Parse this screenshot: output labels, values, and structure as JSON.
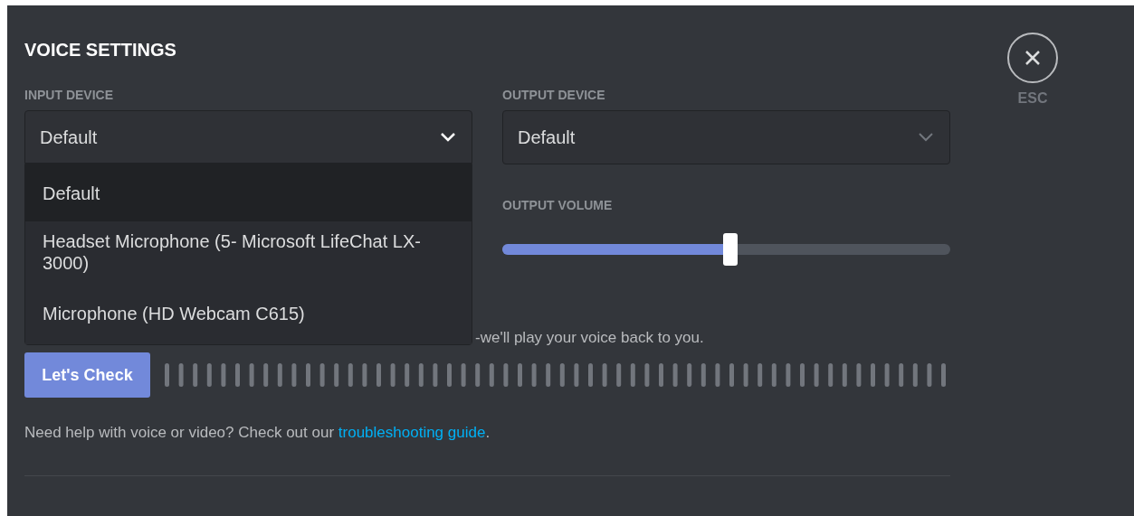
{
  "title": "VOICE SETTINGS",
  "close": {
    "label": "ESC"
  },
  "input_device": {
    "label": "INPUT DEVICE",
    "value": "Default",
    "expanded": true,
    "options": [
      {
        "label": "Default",
        "selected": true
      },
      {
        "label": "Headset Microphone (5- Microsoft LifeChat LX-3000)",
        "selected": false
      },
      {
        "label": "Microphone (HD Webcam C615)",
        "selected": false
      }
    ]
  },
  "output_device": {
    "label": "OUTPUT DEVICE",
    "value": "Default",
    "expanded": false
  },
  "output_volume": {
    "label": "OUTPUT VOLUME",
    "level": 0.51
  },
  "mic_test": {
    "description": "-we'll play your voice back to you.",
    "button": "Let's Check"
  },
  "help": {
    "text": "Need help with voice or video? Check out our ",
    "link": "troubleshooting guide",
    "after": "."
  }
}
